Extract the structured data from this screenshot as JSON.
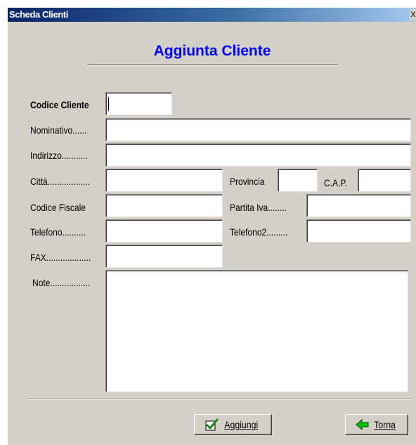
{
  "window": {
    "title": "Scheda Clienti",
    "close_glyph": "X"
  },
  "header": {
    "title": "Aggiunta Cliente"
  },
  "form": {
    "codice_cliente": {
      "label": "Codice Cliente",
      "value": ""
    },
    "nominativo": {
      "label": "Nominativo......",
      "value": ""
    },
    "indirizzo": {
      "label": "Indirizzo...........",
      "value": ""
    },
    "citta": {
      "label": "Città..................",
      "value": ""
    },
    "provincia": {
      "label": "Provincia",
      "value": ""
    },
    "cap": {
      "label": "C.A.P.",
      "value": ""
    },
    "codice_fiscale": {
      "label": "Codice Fiscale",
      "value": ""
    },
    "partita_iva": {
      "label": "Partita Iva........",
      "value": ""
    },
    "telefono": {
      "label": "Telefono..........",
      "value": ""
    },
    "telefono2": {
      "label": "Telefono2.........",
      "value": ""
    },
    "fax": {
      "label": "FAX...................",
      "value": ""
    },
    "note": {
      "label": "Note.................",
      "value": ""
    }
  },
  "buttons": {
    "aggiungi": {
      "label": "Aggiungi",
      "icon": "green-checkmark-icon",
      "icon_color": "#1a8a1a"
    },
    "torna": {
      "label": "Torna",
      "icon": "green-arrow-left-icon",
      "icon_color": "#00c000"
    }
  },
  "colors": {
    "accent": "#0000ff",
    "face": "#d4d0c8",
    "titlebar": "#0a246a"
  }
}
